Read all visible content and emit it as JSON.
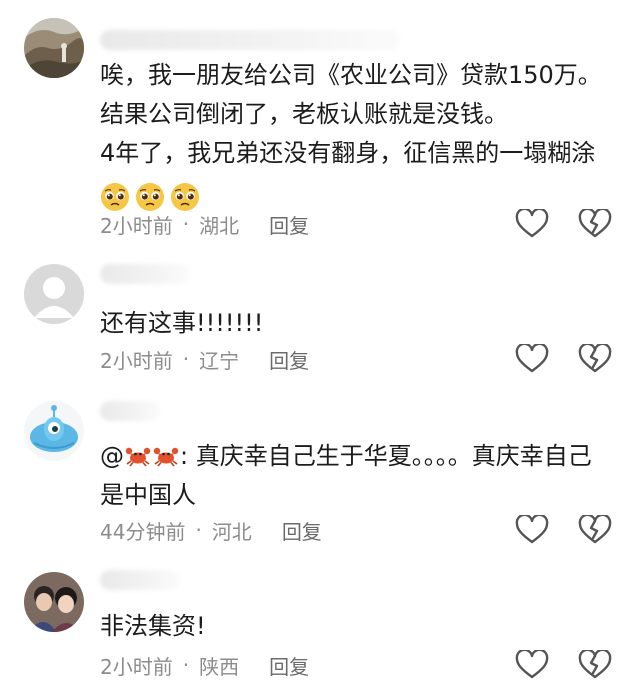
{
  "comments": [
    {
      "avatar": "photo-rock-avatar",
      "lines": [
        "唉，我一朋友给公司《农业公司》贷款150万。",
        "结果公司倒闭了，老板认账就是没钱。",
        "4年了，我兄弟还没有翻身，征信黑的一塌糊涂"
      ],
      "emoji_count": 3,
      "emoji": "pleading-face-emoji",
      "time": "2小时前",
      "sep": "·",
      "location": "湖北",
      "reply_label": "回复"
    },
    {
      "avatar": "default-gray-avatar",
      "lines": [
        "还有这事!!!!!!!"
      ],
      "time": "2小时前",
      "sep": "·",
      "location": "辽宁",
      "reply_label": "回复"
    },
    {
      "avatar": "cartoon-blue-creature-avatar",
      "prefix": "@",
      "crab_count": 2,
      "line1_rest": ": 真庆幸自己生于华夏。。。。真庆幸自己",
      "line2": "是中国人",
      "time": "44分钟前",
      "sep": "·",
      "location": "河北",
      "reply_label": "回复"
    },
    {
      "avatar": "photo-two-girls-avatar",
      "lines": [
        "非法集资!"
      ],
      "time": "2小时前",
      "sep": "·",
      "location": "陕西",
      "reply_label": "回复"
    }
  ],
  "icons": {
    "like": "heart-outline-icon",
    "dislike": "broken-heart-icon"
  },
  "colors": {
    "meta_text": "#8c8c8c",
    "body_text": "#1c1c1c",
    "icon_stroke": "#555555"
  }
}
